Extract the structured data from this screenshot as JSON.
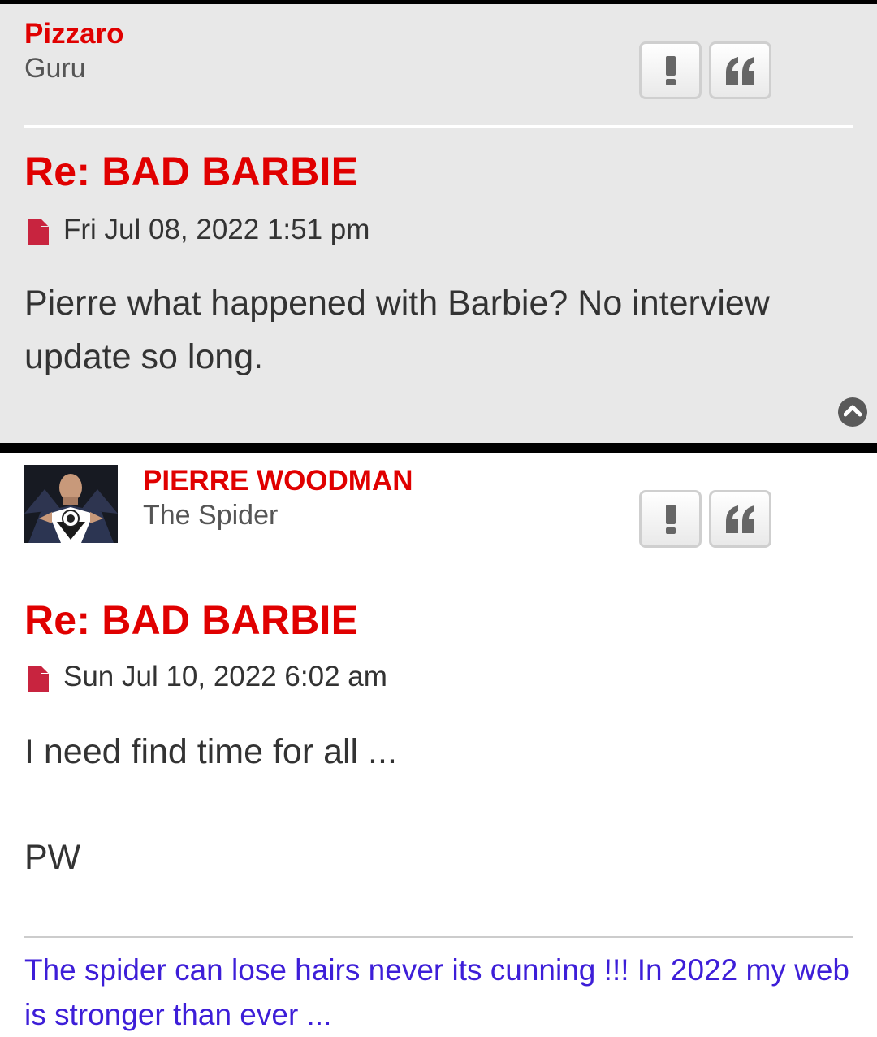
{
  "posts": [
    {
      "author": "Pizzaro",
      "rank": "Guru",
      "title": "Re: BAD BARBIE",
      "date": "Fri Jul 08, 2022 1:51 pm",
      "content": "Pierre what happened with Barbie? No interview update so long."
    },
    {
      "author": "PIERRE WOODMAN",
      "rank": "The Spider",
      "title": "Re: BAD BARBIE",
      "date": "Sun Jul 10, 2022 6:02 am",
      "content_line1": "I need find time for all ...",
      "content_line2": "PW",
      "signature": "The spider can lose hairs never its cunning !!! In 2022 my web is stronger than ever ..."
    }
  ],
  "icons": {
    "report": "exclamation-icon",
    "quote": "quote-icon",
    "post_file": "file-icon",
    "back_to_top": "chevron-up-icon"
  },
  "colors": {
    "accent": "#e00000",
    "signature": "#3d1ed8",
    "post_bg_alt": "#e8e8e8",
    "file_icon": "#c8243f"
  }
}
